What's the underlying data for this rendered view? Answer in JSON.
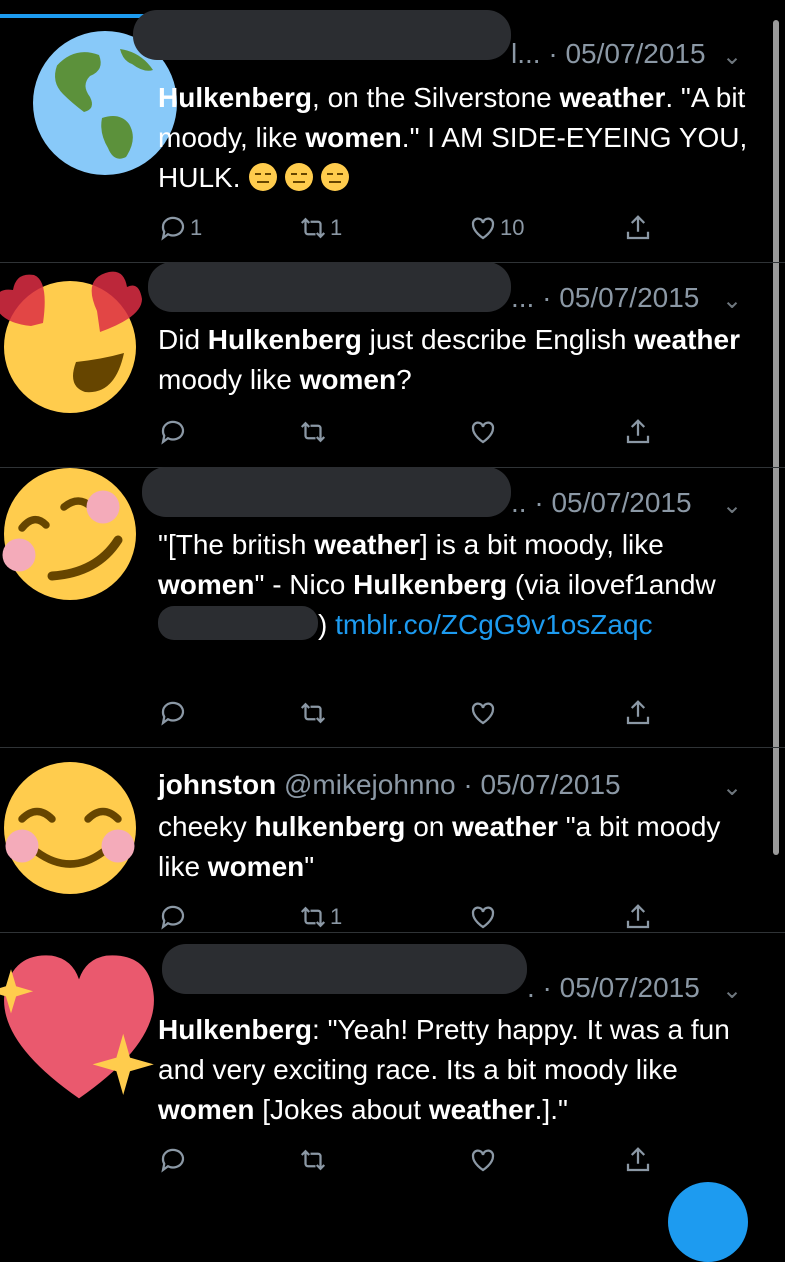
{
  "tweets": [
    {
      "date_prefix": "l... · 05/07/2015",
      "avatar": "globe-americas-emoji",
      "text": [
        {
          "t": "Hulkenberg",
          "b": true
        },
        {
          "t": ", on the Silverstone "
        },
        {
          "t": "weather",
          "b": true
        },
        {
          "t": ". \"A bit moody, like "
        },
        {
          "t": "women",
          "b": true
        },
        {
          "t": ".\" I AM SIDE-EYEING YOU, HULK. "
        }
      ],
      "emoji_tail": [
        "expressionless-face-emoji",
        "expressionless-face-emoji",
        "expressionless-face-emoji"
      ],
      "reply_count": "1",
      "retweet_count": "1",
      "like_count": "10"
    },
    {
      "date_prefix": "... · 05/07/2015",
      "avatar": "heart-eyes-emoji",
      "text": [
        {
          "t": "Did "
        },
        {
          "t": "Hulkenberg",
          "b": true
        },
        {
          "t": " just describe English "
        },
        {
          "t": "weather",
          "b": true
        },
        {
          "t": " moody like "
        },
        {
          "t": "women",
          "b": true
        },
        {
          "t": "?"
        }
      ],
      "reply_count": "",
      "retweet_count": "",
      "like_count": ""
    },
    {
      "date_prefix": "..  · 05/07/2015",
      "avatar": "smiling-blush-emoji",
      "text_before_blur": [
        {
          "t": "\"[The british "
        },
        {
          "t": "weather",
          "b": true
        },
        {
          "t": "] is a bit moody, like "
        },
        {
          "t": "women",
          "b": true
        },
        {
          "t": "\" - Nico "
        },
        {
          "t": "Hulkenberg",
          "b": true
        },
        {
          "t": " (via ilovef1andw"
        }
      ],
      "text_after_blur": ") ",
      "link": "tmblr.co/ZCgG9v1osZaqc",
      "reply_count": "",
      "retweet_count": "",
      "like_count": ""
    },
    {
      "display_name": "johnston",
      "handle_date": "@mikejohnno · 05/07/2015",
      "avatar": "smiling-eyes-emoji",
      "text": [
        {
          "t": "cheeky "
        },
        {
          "t": "hulkenberg",
          "b": true
        },
        {
          "t": " on "
        },
        {
          "t": "weather",
          "b": true
        },
        {
          "t": " \"a bit moody like "
        },
        {
          "t": "women",
          "b": true
        },
        {
          "t": "\""
        }
      ],
      "reply_count": "",
      "retweet_count": "1",
      "like_count": ""
    },
    {
      "date_prefix": ". · 05/07/2015",
      "avatar": "sparkling-heart-emoji",
      "text": [
        {
          "t": "Hulkenberg",
          "b": true
        },
        {
          "t": ": \"Yeah! Pretty happy. It was a fun and very exciting race. Its a bit moody like "
        },
        {
          "t": "women",
          "b": true
        },
        {
          "t": " [Jokes about "
        },
        {
          "t": "weather",
          "b": true
        },
        {
          "t": ".].\""
        }
      ],
      "reply_count": "",
      "retweet_count": "",
      "like_count": ""
    }
  ],
  "icons": {
    "reply": "reply-icon",
    "retweet": "retweet-icon",
    "like": "heart-icon",
    "share": "share-icon",
    "menu": "chevron-down-icon"
  },
  "colors": {
    "accent": "#1d9bf0",
    "muted": "#8b98a5",
    "background": "#000000"
  }
}
